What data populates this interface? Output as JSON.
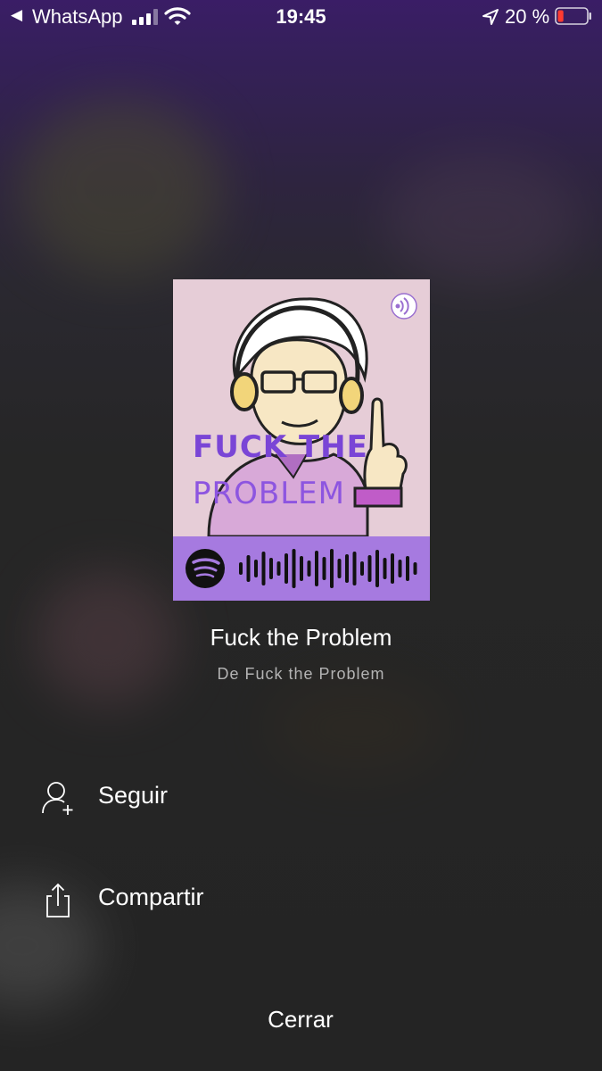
{
  "status_bar": {
    "back_app": "WhatsApp",
    "time": "19:45",
    "battery_percent": "20 %",
    "battery_level": 0.2,
    "signal_bars_filled": 3,
    "signal_bars_total": 4
  },
  "cover": {
    "title_line1": "FUCK THE",
    "title_line2": "PROBLEM",
    "art_background": "#e6cdd7",
    "code_strip_color": "#a67ae0",
    "icons": [
      "podcast-icon",
      "spotify-logo-icon",
      "spotify-code-icon"
    ]
  },
  "episode": {
    "title": "Fuck the Problem",
    "subtitle": "De Fuck the Problem"
  },
  "menu": [
    {
      "id": "follow",
      "label": "Seguir",
      "icon": "add-person-icon"
    },
    {
      "id": "share",
      "label": "Compartir",
      "icon": "share-icon"
    }
  ],
  "close_label": "Cerrar",
  "colors": {
    "top_gradient": "#3a1d66",
    "background": "#242424",
    "secondary_text": "#b3b3b3"
  }
}
